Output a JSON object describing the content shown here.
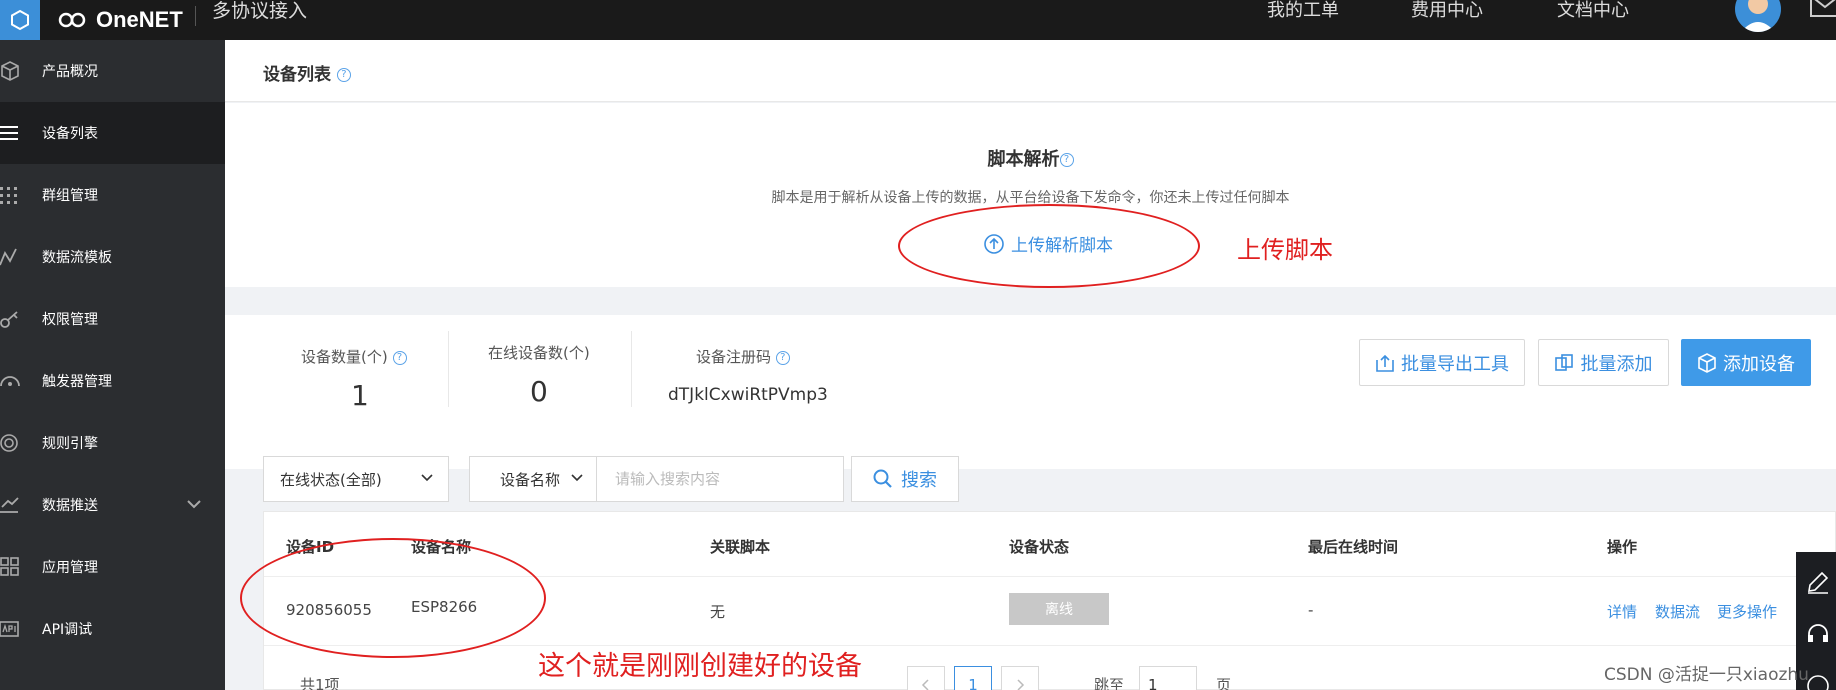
{
  "topbar": {
    "brand": "OneNET",
    "product": "多协议接入",
    "links": [
      "我的工单",
      "费用中心",
      "文档中心"
    ]
  },
  "sidebar": {
    "items": [
      {
        "label": "产品概况",
        "icon": "cube-icon"
      },
      {
        "label": "设备列表",
        "icon": "list-icon",
        "active": true
      },
      {
        "label": "群组管理",
        "icon": "grid-dots-icon"
      },
      {
        "label": "数据流模板",
        "icon": "trend-icon"
      },
      {
        "label": "权限管理",
        "icon": "key-icon"
      },
      {
        "label": "触发器管理",
        "icon": "gauge-icon"
      },
      {
        "label": "规则引擎",
        "icon": "target-icon"
      },
      {
        "label": "数据推送",
        "icon": "push-icon",
        "expandable": true
      },
      {
        "label": "应用管理",
        "icon": "apps-icon"
      },
      {
        "label": "API调试",
        "icon": "api-icon"
      }
    ]
  },
  "page": {
    "title": "设备列表",
    "help": "?"
  },
  "script": {
    "title": "脚本解析",
    "description": "脚本是用于解析从设备上传的数据，从平台给设备下发命令，你还未上传过任何脚本",
    "upload_label": "上传解析脚本"
  },
  "annotations": {
    "upload": "上传脚本",
    "device": "这个就是刚刚创建好的设备"
  },
  "stats": {
    "count_label": "设备数量(个)",
    "count_value": "1",
    "online_label": "在线设备数(个)",
    "online_value": "0",
    "code_label": "设备注册码",
    "code_value": "dTJklCxwiRtPVmp3"
  },
  "actions": {
    "export": "批量导出工具",
    "batch_add": "批量添加",
    "add": "添加设备"
  },
  "filters": {
    "status": "在线状态(全部)",
    "field": "设备名称",
    "placeholder": "请输入搜索内容",
    "search": "搜索"
  },
  "table": {
    "headers": [
      "设备ID",
      "设备名称",
      "关联脚本",
      "设备状态",
      "最后在线时间",
      "操作"
    ],
    "rows": [
      {
        "id": "920856055",
        "name": "ESP8266",
        "script": "无",
        "status": "离线",
        "last_online": "-",
        "ops": [
          "详情",
          "数据流",
          "更多操作"
        ]
      }
    ]
  },
  "pagination": {
    "total": "共1项",
    "current": "1",
    "jump_label": "跳至",
    "jump_value": "1",
    "page_suffix": "页"
  },
  "watermark": "CSDN @活捉一只xiaozhu",
  "colors": {
    "accent": "#3b8fe0",
    "primary_button": "#3f9ae8",
    "sidebar": "#2b2d30",
    "topbar": "#1a1a1a",
    "annotation": "#e02020"
  }
}
